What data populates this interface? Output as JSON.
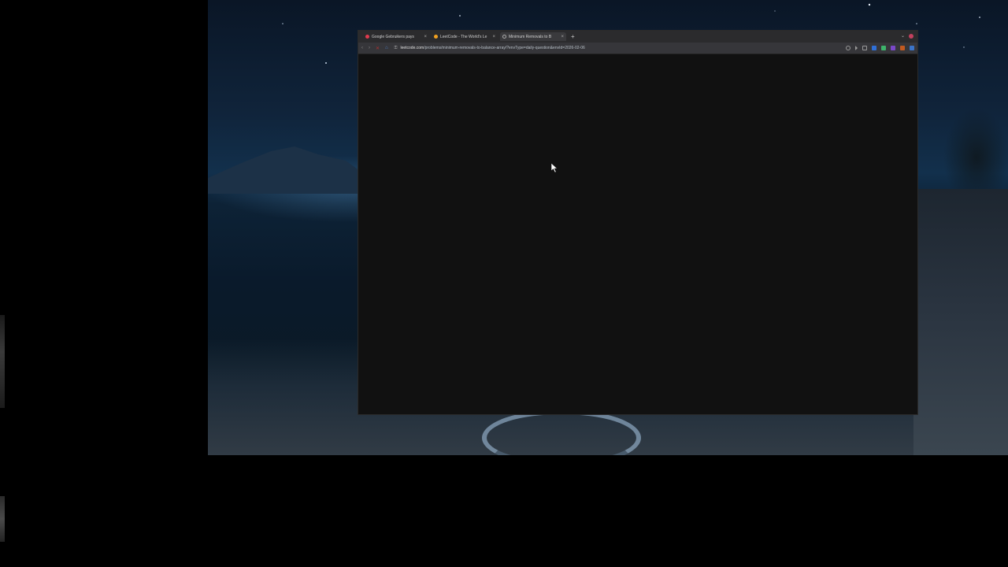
{
  "browser": {
    "tabs": [
      {
        "label": "Google Gebruikers pays",
        "favicon_color": "#e03a4e",
        "active": false
      },
      {
        "label": "LeetCode - The World's Le",
        "favicon_color": "#f0a020",
        "active": false
      },
      {
        "label": "Minimum Removals to B",
        "favicon_color": "#aaaaaa",
        "active": true
      }
    ],
    "new_tab_label": "+",
    "close_glyph": "×",
    "address": {
      "host": "leetcode.com",
      "path": "/problems/minimum-removals-to-balance-array/?envType=daily-question&envId=2026-02-06"
    }
  },
  "colors": {
    "accent_window_close": "#c2405e",
    "page_background": "#111111"
  },
  "icons": {
    "back": "chevron-left-icon",
    "forward": "chevron-right-icon",
    "reload": "stop-icon",
    "home": "home-icon",
    "site": "lock-icon",
    "extensions": [
      "zoom-icon",
      "cast-icon",
      "bookmark-icon",
      "extension-icon",
      "profile-icon",
      "menu-icon"
    ]
  }
}
